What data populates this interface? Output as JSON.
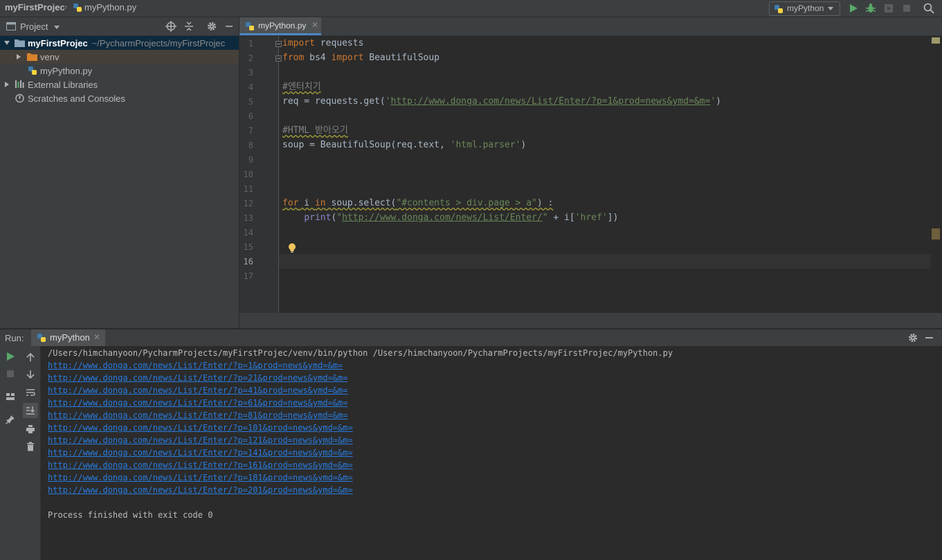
{
  "navbar": {
    "project": "myFirstProjec",
    "file": "myPython.py",
    "run_config": "myPython"
  },
  "project_panel": {
    "title": "Project",
    "tree": {
      "root_name": "myFirstProjec",
      "root_path": "~/PycharmProjects/myFirstProjec",
      "venv": "venv",
      "file": "myPython.py",
      "external": "External Libraries",
      "scratches": "Scratches and Consoles"
    }
  },
  "editor": {
    "tab": "myPython.py",
    "line_numbers": [
      "1",
      "2",
      "3",
      "4",
      "5",
      "6",
      "7",
      "8",
      "9",
      "10",
      "11",
      "12",
      "13",
      "14",
      "15",
      "16",
      "17"
    ],
    "current_line": "16",
    "code": {
      "l1_kw": "import",
      "l1_rest": " requests",
      "l2_kw1": "from",
      "l2_mid": " bs4 ",
      "l2_kw2": "import",
      "l2_rest": " BeautifulSoup",
      "l4": "#엔터치기",
      "l5_pre": "req = requests.get(",
      "l5_q1": "'",
      "l5_url": "http://www.donga.com/news/List/Enter/?p=1&prod=news&ymd=&m=",
      "l5_q2": "'",
      "l5_post": ")",
      "l7": "#HTML 받아오기",
      "l8_pre": "soup = BeautifulSoup(req.text, ",
      "l8_str": "'html.parser'",
      "l8_post": ")",
      "l12_kw1": "for",
      "l12_a": " i ",
      "l12_kw2": "in",
      "l12_b": " soup.select(",
      "l12_str": "\"#contents > div.page > a\"",
      "l12_c": ") :",
      "l13_indent": "    ",
      "l13_fn": "print",
      "l13_a": "(",
      "l13_q1": "\"",
      "l13_url": "http://www.donga.com/news/List/Enter/",
      "l13_q2": "\"",
      "l13_b": " + i[",
      "l13_str": "'href'",
      "l13_c": "])"
    }
  },
  "run": {
    "label": "Run:",
    "tab": "myPython",
    "command": "/Users/himchanyoon/PycharmProjects/myFirstProjec/venv/bin/python /Users/himchanyoon/PycharmProjects/myFirstProjec/myPython.py",
    "output": [
      "http://www.donga.com/news/List/Enter/?p=1&prod=news&ymd=&m=",
      "http://www.donga.com/news/List/Enter/?p=21&prod=news&ymd=&m=",
      "http://www.donga.com/news/List/Enter/?p=41&prod=news&ymd=&m=",
      "http://www.donga.com/news/List/Enter/?p=61&prod=news&ymd=&m=",
      "http://www.donga.com/news/List/Enter/?p=81&prod=news&ymd=&m=",
      "http://www.donga.com/news/List/Enter/?p=101&prod=news&ymd=&m=",
      "http://www.donga.com/news/List/Enter/?p=121&prod=news&ymd=&m=",
      "http://www.donga.com/news/List/Enter/?p=141&prod=news&ymd=&m=",
      "http://www.donga.com/news/List/Enter/?p=161&prod=news&ymd=&m=",
      "http://www.donga.com/news/List/Enter/?p=181&prod=news&ymd=&m=",
      "http://www.donga.com/news/List/Enter/?p=201&prod=news&ymd=&m="
    ],
    "exit": "Process finished with exit code 0"
  },
  "colors": {
    "background": "#2b2b2b",
    "panel": "#3c3f41",
    "keyword": "#cc7832",
    "string": "#6a8759",
    "comment": "#808080",
    "link": "#287bde",
    "run_green": "#59a869",
    "selection": "#0d293e"
  }
}
